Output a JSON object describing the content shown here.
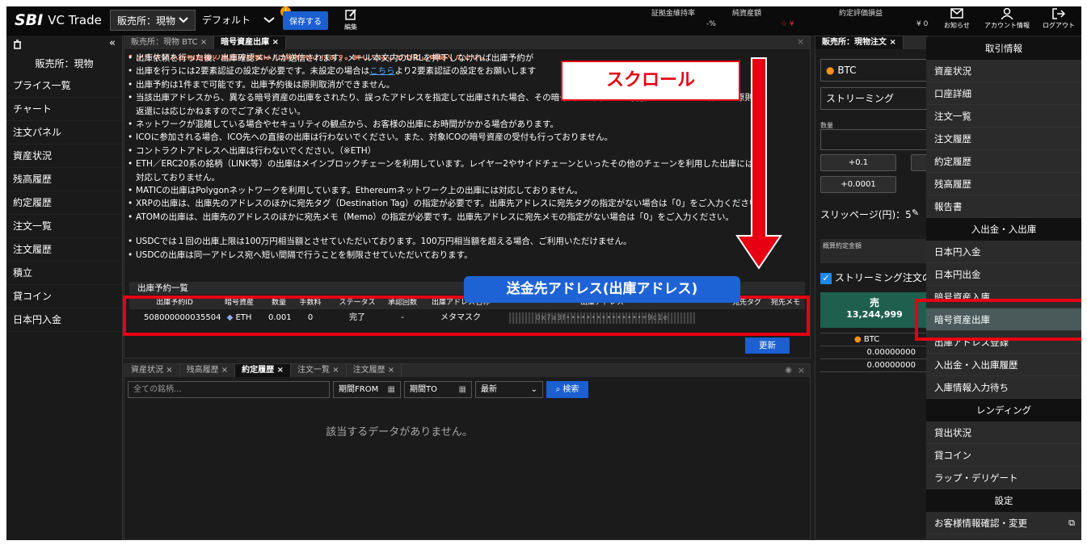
{
  "topbar": {
    "logo_sbi": "SBI",
    "logo_vc": "VC Trade",
    "market_select": "販売所：現物",
    "layout_select": "デフォルト",
    "badge": "!",
    "save": "保存する",
    "edit": "編集",
    "stats": [
      {
        "label": "証拠金維持率",
        "value": "-%"
      },
      {
        "label": "純資産額",
        "value": "☆ ¥"
      },
      {
        "label": "約定評価損益",
        "value": "¥ 0"
      }
    ],
    "notice": "お知らせ",
    "account": "アカウント情報",
    "logout": "ログアウト"
  },
  "sidebar": {
    "collapse": "«",
    "title": "販売所：現物",
    "items": [
      "プライス一覧",
      "チャート",
      "注文パネル",
      "資産状況",
      "残高履歴",
      "約定履歴",
      "注文一覧",
      "注文履歴",
      "積立",
      "貸コイン",
      "日本円入金"
    ]
  },
  "main_tabs": [
    {
      "label": "販売所：現物 BTC",
      "close": "×"
    },
    {
      "label": "暗号資産出庫",
      "close": "×"
    }
  ],
  "notice_top": "クイック入金相当額の資産の移転は7日間制限されます。詳しくはこちらをご確認ください。",
  "bullets": [
    "出庫依頼を行った後、出庫確認メールが送信されます。メール本文内のURLを押下しなければ出庫予約が",
    "出庫を行うには2要素認証の設定が必要です。未設定の場合は|こちら|より2要素認証の設定をお願いします",
    "出庫予約は1件まで可能です。出庫予約後は原則取消ができません。",
    "当該出庫アドレスから、異なる暗号資産の出庫をされたり、誤ったアドレスを指定して出庫された場合、その暗号資産は失われる可能性があります。当社では原則",
    "返還には応じかねますのでご了承ください。",
    "ネットワークが混雑している場合やセキュリティの観点から、お客様の出庫にお時間がかかる場合があります。",
    "ICOに参加される場合、ICO先への直接の出庫は行わないでください。また、対象ICOの暗号資産の受付も行っておりません。",
    "コントラクトアドレスへ出庫は行わないでください。（※ETH）",
    "ETH／ERC20系の銘柄（LINK等）の出庫はメインブロックチェーンを利用しています。レイヤー2やサイドチェーンといったその他のチェーンを利用した出庫には",
    "対応しておりません。",
    "MATICの出庫はPolygonネットワークを利用しています。Ethereumネットワーク上の出庫には対応しておりません。",
    "XRPの出庫は、出庫先のアドレスのほかに宛先タグ（Destination Tag）の指定が必要です。出庫先アドレスに宛先タグの指定がない場合は「0」をご入力ください。",
    "ATOMの出庫は、出庫先のアドレスのほかに宛先メモ（Memo）の指定が必要です。出庫先アドレスに宛先メモの指定がない場合は「0」をご入力ください。",
    "",
    "USDCでは１回の出庫上限は100万円相当額とさせていただいております。100万円相当額を超える場合、ご利用いただけません。",
    "USDCの出庫は同一アドレス宛へ短い間隔で行うことを制限させていただいております。"
  ],
  "reservation": {
    "title": "出庫予約一覧",
    "headers": [
      "出庫予約ID",
      "暗号資産",
      "数量",
      "手数料",
      "ステータス",
      "承認回数",
      "出庫アドレス名称",
      "出庫アドレス",
      "宛先タグ",
      "宛先メモ"
    ],
    "row": [
      "508000000035504",
      "ETH",
      "0.001",
      "0",
      "完了",
      "-",
      "メタマスク",
      "0x7a3f••••••••••••••••9c1e",
      "",
      ""
    ],
    "refresh": "更新"
  },
  "bottom_tabs": [
    "資産状況",
    "残高履歴",
    "約定履歴",
    "注文一覧",
    "注文履歴"
  ],
  "filter": {
    "placeholder": "全ての銘柄...",
    "from": "期間FROM",
    "to": "期間TO",
    "sort": "最新",
    "search": "検索"
  },
  "empty": "該当するデータがありません。",
  "right_panel": {
    "tab": "販売所：現物注文",
    "coin": "BTC",
    "mode": "ストリーミング",
    "qty_label": "数量",
    "step1": "+0.1",
    "step2": "+0.0001",
    "slippage": "スリッページ(円)：5",
    "est_label": "概算約定金額",
    "stream_check": "ストリーミング注文の",
    "sell": "売",
    "sell_price": "13,244,999",
    "bal_coin": "BTC",
    "bal1": "0.00000000",
    "bal2": "0.00000000"
  },
  "menu": [
    {
      "type": "h",
      "label": "取引情報"
    },
    {
      "type": "i",
      "label": "資産状況"
    },
    {
      "type": "i",
      "label": "口座詳細"
    },
    {
      "type": "i",
      "label": "注文一覧"
    },
    {
      "type": "i",
      "label": "注文履歴"
    },
    {
      "type": "i",
      "label": "約定履歴"
    },
    {
      "type": "i",
      "label": "残高履歴"
    },
    {
      "type": "i",
      "label": "報告書"
    },
    {
      "type": "h",
      "label": "入出金・入出庫"
    },
    {
      "type": "i",
      "label": "日本円入金"
    },
    {
      "type": "i",
      "label": "日本円出金"
    },
    {
      "type": "i",
      "label": "暗号資産入庫"
    },
    {
      "type": "s",
      "label": "暗号資産出庫"
    },
    {
      "type": "i",
      "label": "出庫アドレス登録"
    },
    {
      "type": "i",
      "label": "入出金・入出庫履歴"
    },
    {
      "type": "i",
      "label": "入庫情報入力待ち"
    },
    {
      "type": "h",
      "label": "レンディング"
    },
    {
      "type": "i",
      "label": "貸出状況"
    },
    {
      "type": "i",
      "label": "貸コイン"
    },
    {
      "type": "i",
      "label": "ラップ・デリゲート"
    },
    {
      "type": "h",
      "label": "設定"
    },
    {
      "type": "i",
      "label": "お客様情報確認・変更"
    }
  ],
  "callouts": {
    "scroll": "スクロール",
    "address": "送金先アドレス(出庫アドレス)"
  }
}
